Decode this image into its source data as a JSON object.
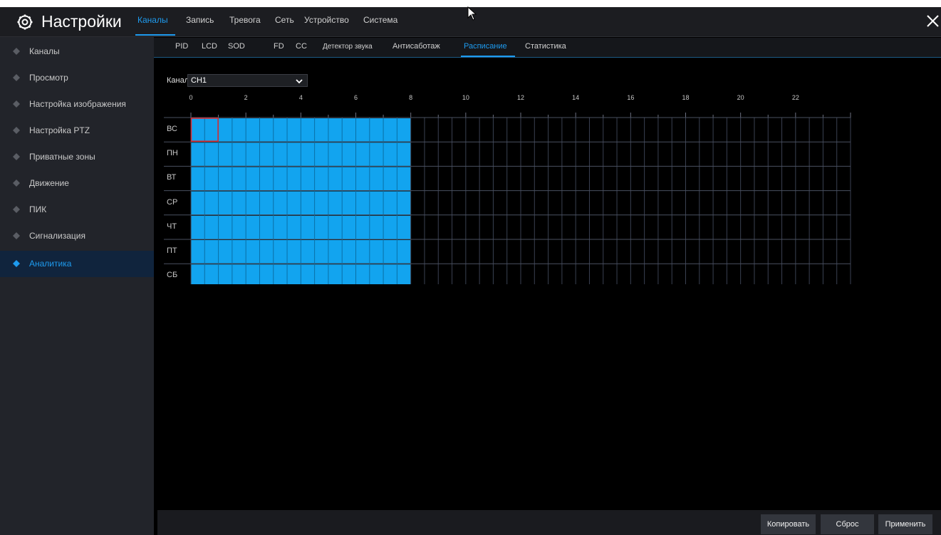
{
  "header": {
    "title": "Настройки",
    "tabs": [
      {
        "label": "Каналы",
        "active": true
      },
      {
        "label": "Запись",
        "active": false
      },
      {
        "label": "Тревога",
        "active": false
      },
      {
        "label": "Сеть",
        "active": false
      },
      {
        "label": "Устройство",
        "active": false
      },
      {
        "label": "Система",
        "active": false
      }
    ]
  },
  "sidebar": {
    "items": [
      {
        "label": "Каналы",
        "active": false
      },
      {
        "label": "Просмотр",
        "active": false
      },
      {
        "label": "Настройка изображения",
        "active": false
      },
      {
        "label": "Настройка PTZ",
        "active": false
      },
      {
        "label": "Приватные зоны",
        "active": false
      },
      {
        "label": "Движение",
        "active": false
      },
      {
        "label": "ПИК",
        "active": false
      },
      {
        "label": "Сигнализация",
        "active": false
      },
      {
        "label": "Аналитика",
        "active": true
      }
    ]
  },
  "subtabs": [
    {
      "label": "PID",
      "active": false
    },
    {
      "label": "LCD",
      "active": false
    },
    {
      "label": "SOD",
      "active": false
    },
    {
      "label": "FD",
      "active": false
    },
    {
      "label": "CC",
      "active": false
    },
    {
      "label": "Детектор звука",
      "active": false
    },
    {
      "label": "Антисаботаж",
      "active": false
    },
    {
      "label": "Расписание",
      "active": true
    },
    {
      "label": "Статистика",
      "active": false
    }
  ],
  "channel": {
    "label": "Канал",
    "value": "CH1"
  },
  "schedule": {
    "hour_labels": [
      "0",
      "2",
      "4",
      "6",
      "8",
      "10",
      "12",
      "14",
      "16",
      "18",
      "20",
      "22"
    ],
    "days": [
      "ВС",
      "ПН",
      "ВТ",
      "СР",
      "ЧТ",
      "ПТ",
      "СБ"
    ],
    "active_from_hour": 0,
    "active_to_hour": 8,
    "selected_cell": {
      "day": "ВС",
      "hour": 0
    }
  },
  "buttons": {
    "copy": "Копировать",
    "reset": "Сброс",
    "apply": "Применить"
  },
  "colors": {
    "accent": "#1e9bef",
    "schedule_fill": "#12a4ef",
    "selection": "#e0282e"
  }
}
